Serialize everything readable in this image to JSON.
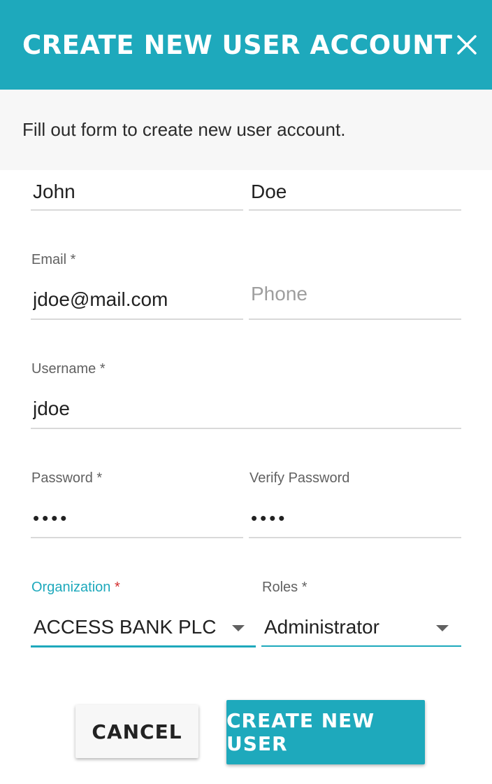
{
  "dialog": {
    "title": "CREATE NEW USER ACCOUNT",
    "subtitle": "Fill out form to create new user account."
  },
  "form": {
    "first_name": {
      "value": "John"
    },
    "last_name": {
      "value": "Doe"
    },
    "email": {
      "label": "Email",
      "required_mark": "*",
      "value": "jdoe@mail.com"
    },
    "phone": {
      "placeholder": "Phone",
      "value": ""
    },
    "username": {
      "label": "Username",
      "required_mark": "*",
      "value": "jdoe"
    },
    "password": {
      "label": "Password",
      "required_mark": "*",
      "value": "••••"
    },
    "verify_password": {
      "label": "Verify Password",
      "value": "••••"
    },
    "organization": {
      "label": "Organization",
      "required_mark": "*",
      "value": "ACCESS BANK PLC",
      "focused": true
    },
    "roles": {
      "label": "Roles",
      "required_mark": "*",
      "value": "Administrator"
    }
  },
  "actions": {
    "cancel_label": "CANCEL",
    "create_label": "CREATE NEW USER"
  },
  "colors": {
    "accent": "#1ea9bc",
    "required_focused": "#d32f2f"
  },
  "icons": {
    "close": "close-icon",
    "dropdown": "chevron-down-icon"
  }
}
